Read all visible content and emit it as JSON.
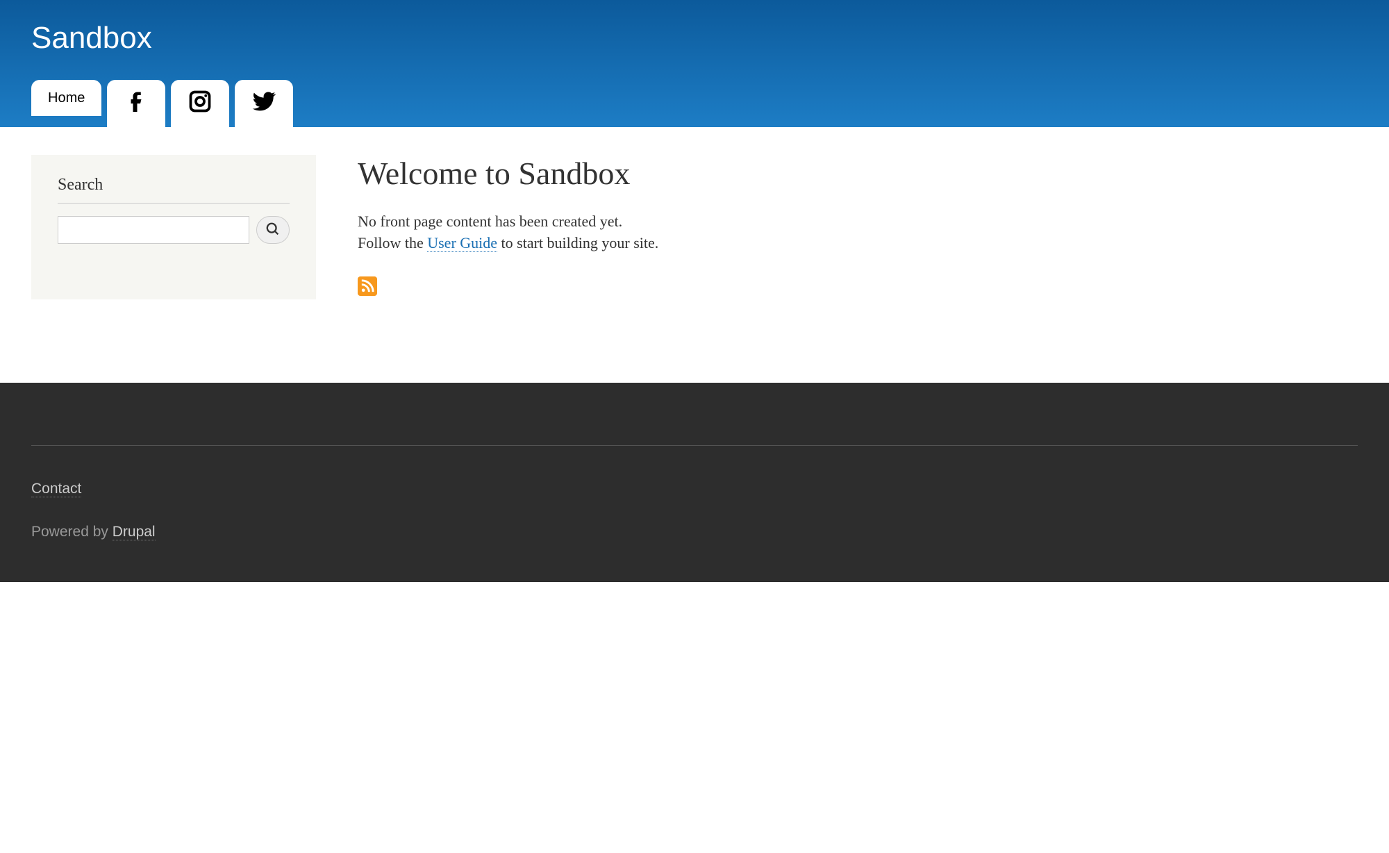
{
  "header": {
    "site_title": "Sandbox",
    "nav": {
      "home_label": "Home"
    }
  },
  "sidebar": {
    "search_label": "Search",
    "search_value": ""
  },
  "main": {
    "page_title": "Welcome to Sandbox",
    "line1": "No front page content has been created yet.",
    "line2_before": "Follow the ",
    "line2_link": "User Guide",
    "line2_after": " to start building your site."
  },
  "footer": {
    "contact_label": "Contact",
    "powered_prefix": "Powered by ",
    "powered_link": "Drupal"
  }
}
